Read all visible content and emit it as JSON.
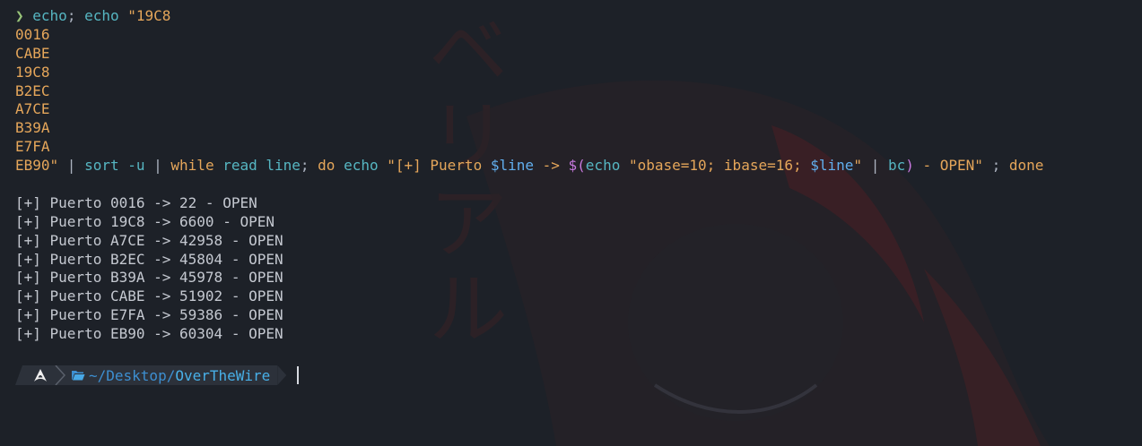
{
  "command": {
    "prompt_symbol": "❯",
    "line1": {
      "echo1": "echo",
      "semi": ";",
      "echo2": "echo",
      "string": " \"19C8"
    },
    "values": [
      "0016",
      "CABE",
      "19C8",
      "B2EC",
      "A7CE",
      "B39A",
      "E7FA"
    ],
    "last_line": {
      "val": "EB90\"",
      "pipe1": " | ",
      "sort": "sort",
      "sort_arg": " -u ",
      "pipe2": "| ",
      "while": "while",
      "read": " read ",
      "line_var": "line",
      "semi1": "; ",
      "do": "do",
      "echo": " echo ",
      "str1": "\"[+] Puerto ",
      "var1": "$line",
      "arrow": " -> ",
      "subst": "$(",
      "echo2": "echo",
      "str2": " \"obase=10; ibase=16; ",
      "var2": "$line",
      "str2_end": "\"",
      "pipe3": " | ",
      "bc": "bc",
      "paren": ")",
      "str3": " - OPEN\"",
      "semi2": " ; ",
      "done": "done"
    }
  },
  "output": [
    "[+] Puerto 0016 -> 22 - OPEN",
    "[+] Puerto 19C8 -> 6600 - OPEN",
    "[+] Puerto A7CE -> 42958 - OPEN",
    "[+] Puerto B2EC -> 45804 - OPEN",
    "[+] Puerto B39A -> 45978 - OPEN",
    "[+] Puerto CABE -> 51902 - OPEN",
    "[+] Puerto E7FA -> 59386 - OPEN",
    "[+] Puerto EB90 -> 60304 - OPEN"
  ],
  "prompt": {
    "os_icon": "arch-linux-icon",
    "folder_icon": "folder-open-icon",
    "path_prefix": "~/Desktop/",
    "path_last": "OverTheWire"
  },
  "background_kana": "ベ\nリ\nア\nル"
}
